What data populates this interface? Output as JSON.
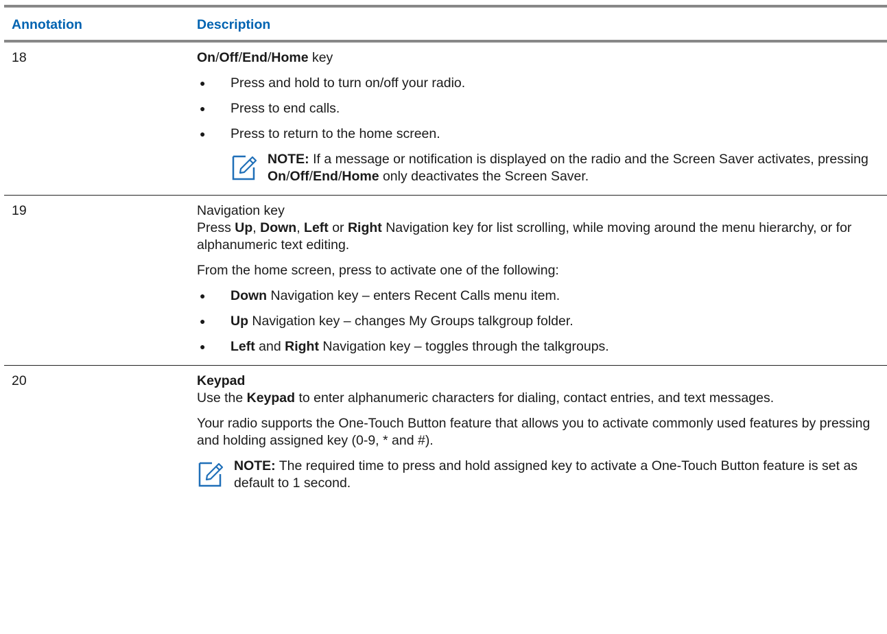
{
  "header": {
    "annotation": "Annotation",
    "description": "Description"
  },
  "rows": [
    {
      "num": "18",
      "title": {
        "parts": [
          "On",
          "/",
          "Off",
          "/",
          "End",
          "/",
          "Home"
        ],
        "suffix": " key"
      },
      "bullets": [
        "Press and hold to turn on/off your radio.",
        "Press to end calls.",
        "Press to return to the home screen."
      ],
      "note": {
        "label": "NOTE:",
        "text1": " If a message or notification is displayed on the radio and the Screen Saver activates, pressing ",
        "key_parts": [
          "On",
          "/",
          "Off",
          "/",
          "End",
          "/",
          "Home"
        ],
        "text2": " only deactivates the Screen Saver."
      }
    },
    {
      "num": "19",
      "title": "Navigation key",
      "p1": {
        "t0": "Press ",
        "k1": "Up",
        "t1": ", ",
        "k2": "Down",
        "t2": ", ",
        "k3": "Left",
        "t3": " or ",
        "k4": "Right",
        "t4": " Navigation key for list scrolling, while moving around the menu hierarchy, or for alphanumeric text editing."
      },
      "p2": "From the home screen, press to activate one of the following:",
      "bullets": [
        {
          "k": "Down",
          "t": " Navigation key – enters Recent Calls menu item."
        },
        {
          "k": "Up",
          "t": " Navigation key – changes My Groups talkgroup folder."
        },
        {
          "k": "Left",
          "m": " and ",
          "k2": "Right",
          "t": " Navigation key – toggles through the talkgroups."
        }
      ]
    },
    {
      "num": "20",
      "title": "Keypad",
      "p1": {
        "t0": "Use the ",
        "k": "Keypad",
        "t1": " to enter alphanumeric characters for dialing, contact entries, and text messages."
      },
      "p2": "Your radio supports the One-Touch Button feature that allows you to activate com­monly used features by pressing and holding assigned key (0-9, * and #).",
      "note": {
        "label": "NOTE:",
        "text": " The required time to press and hold assigned key to activate a One-Touch Button feature is set as default to 1 second."
      }
    }
  ],
  "colors": {
    "heading_blue": "#0063b1",
    "rule_gray": "#888888",
    "note_icon": "#1f6fb8"
  }
}
